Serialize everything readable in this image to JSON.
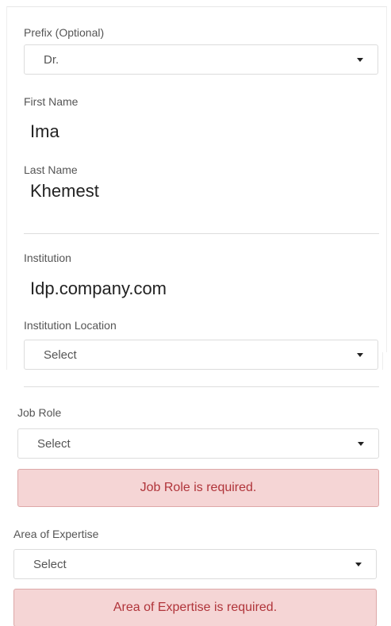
{
  "prefix": {
    "label": "Prefix (Optional)",
    "selected": "Dr."
  },
  "first_name": {
    "label": "First Name",
    "value": "Ima"
  },
  "last_name": {
    "label": "Last Name",
    "value": "Khemest"
  },
  "institution": {
    "label": "Institution",
    "value": "Idp.company.com"
  },
  "institution_location": {
    "label": "Institution Location",
    "selected": "Select"
  },
  "job_role": {
    "label": "Job Role",
    "selected": "Select",
    "error": "Job Role is required."
  },
  "area_of_expertise": {
    "label": "Area of Expertise",
    "selected": "Select",
    "error": "Area of Expertise is required."
  },
  "icons": {
    "dropdown": "caret-down-icon"
  },
  "colors": {
    "error_bg": "#f5d5d5",
    "error_border": "#dda8a8",
    "error_text": "#b0343a"
  }
}
